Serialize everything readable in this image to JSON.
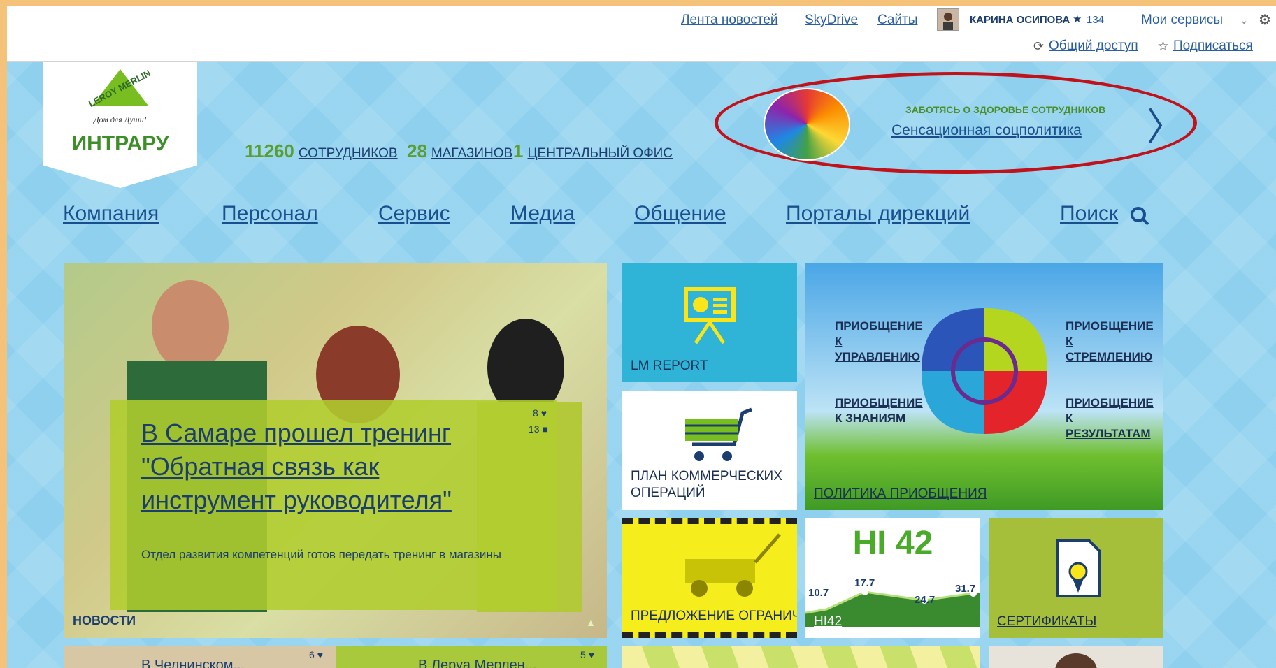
{
  "topbar": {
    "links": [
      "Лента новостей",
      "SkyDrive",
      "Сайты"
    ],
    "user_name": "КАРИНА ОСИПОВА",
    "star_count": "134",
    "services": "Мои сервисы",
    "share": "Общий доступ",
    "subscribe": "Подписаться"
  },
  "logo": {
    "brand": "LEROY MERLIN",
    "tagline": "Дом для Души!",
    "name": "ИНТРАРУ"
  },
  "stats": [
    {
      "num": "11260",
      "label": "СОТРУДНИКОВ"
    },
    {
      "num": "28",
      "label": "МАГАЗИНОВ"
    },
    {
      "num": "1",
      "label": "ЦЕНТРАЛЬНЫЙ ОФИС"
    }
  ],
  "promo": {
    "subtitle": "ЗАБОТЯСЬ О ЗДОРОВЬЕ СОТРУДНИКОВ",
    "title": "Сенсационная соцполитика"
  },
  "nav": [
    "Компания",
    "Персонал",
    "Сервис",
    "Медиа",
    "Общение",
    "Порталы дирекций",
    "Поиск"
  ],
  "news": {
    "title": "В Самаре прошел тренинг \"Обратная связь как инструмент руководителя\"",
    "desc": "Отдел развития компетенций готов передать тренинг в магазины",
    "likes": "8",
    "comments": "13",
    "section": "НОВОСТИ"
  },
  "tiles": {
    "lm_report": "LM REPORT",
    "plan": "ПЛАН КОММЕРЧЕСКИХ ОПЕРАЦИЙ",
    "offer": "ПРЕДЛОЖЕНИЕ ОГРАНИЧЕНО",
    "hi42_label": "HI42",
    "hi42_big": "HI 42",
    "certificates": "СЕРТИФИКАТЫ",
    "policy": "ПОЛИТИКА ПРИОБЩЕНИЯ",
    "leaf_tl": "ПРИОБЩЕНИЕ К УПРАВЛЕНИЮ",
    "leaf_tr": "ПРИОБЩЕНИЕ К СТРЕМЛЕНИЮ",
    "leaf_bl": "ПРИОБЩЕНИЕ К ЗНАНИЯМ",
    "leaf_br": "ПРИОБЩЕНИЕ К РЕЗУЛЬТАТАМ"
  },
  "hi42_values": [
    "10.7",
    "17.7",
    "24.7",
    "31.7"
  ],
  "bottom": {
    "news1": "В Челнинском...",
    "news1_count": "6",
    "news2": "В Леруа Мерлен...",
    "news2_count": "5"
  },
  "colors": {
    "accent_green": "#78be20",
    "blue_bg": "#8fd0ef",
    "promo_ring": "#c0121b"
  }
}
